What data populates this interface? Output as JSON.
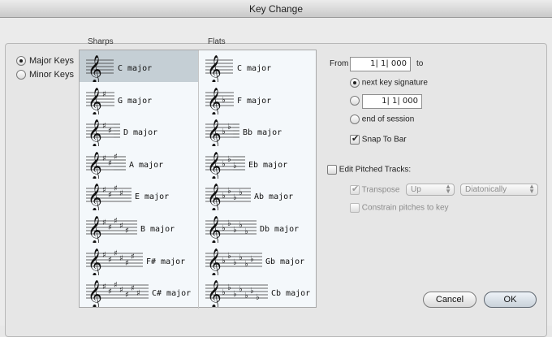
{
  "window": {
    "title": "Key Change"
  },
  "mode": {
    "options": [
      {
        "label": "Major Keys",
        "selected": true
      },
      {
        "label": "Minor Keys",
        "selected": false
      }
    ]
  },
  "columns": {
    "sharps": "Sharps",
    "flats": "Flats"
  },
  "sharps": [
    {
      "label": "C major",
      "accidentals": 0,
      "selected": true
    },
    {
      "label": "G major",
      "accidentals": 1
    },
    {
      "label": "D major",
      "accidentals": 2
    },
    {
      "label": "A major",
      "accidentals": 3
    },
    {
      "label": "E major",
      "accidentals": 4
    },
    {
      "label": "B major",
      "accidentals": 5
    },
    {
      "label": "F# major",
      "accidentals": 6
    },
    {
      "label": "C# major",
      "accidentals": 7
    }
  ],
  "flats": [
    {
      "label": "C major",
      "accidentals": 0
    },
    {
      "label": "F major",
      "accidentals": 1
    },
    {
      "label": "Bb major",
      "accidentals": 2
    },
    {
      "label": "Eb major",
      "accidentals": 3
    },
    {
      "label": "Ab major",
      "accidentals": 4
    },
    {
      "label": "Db major",
      "accidentals": 5
    },
    {
      "label": "Gb major",
      "accidentals": 6
    },
    {
      "label": "Cb major",
      "accidentals": 7
    }
  ],
  "range": {
    "from_label": "From",
    "from_value": "1| 1| 000",
    "to_label": "to",
    "next_key_label": "next key signature",
    "to_value": "1| 1| 000",
    "end_label": "end of session",
    "selected": "next key signature"
  },
  "snap": {
    "label": "Snap To Bar",
    "checked": true
  },
  "pitched": {
    "label": "Edit Pitched Tracks:",
    "checked": false,
    "transpose_label": "Transpose",
    "transpose_checked": true,
    "direction_value": "Up",
    "method_value": "Diatonically",
    "constrain_label": "Constrain pitches to key",
    "constrain_checked": false
  },
  "buttons": {
    "cancel": "Cancel",
    "ok": "OK"
  }
}
